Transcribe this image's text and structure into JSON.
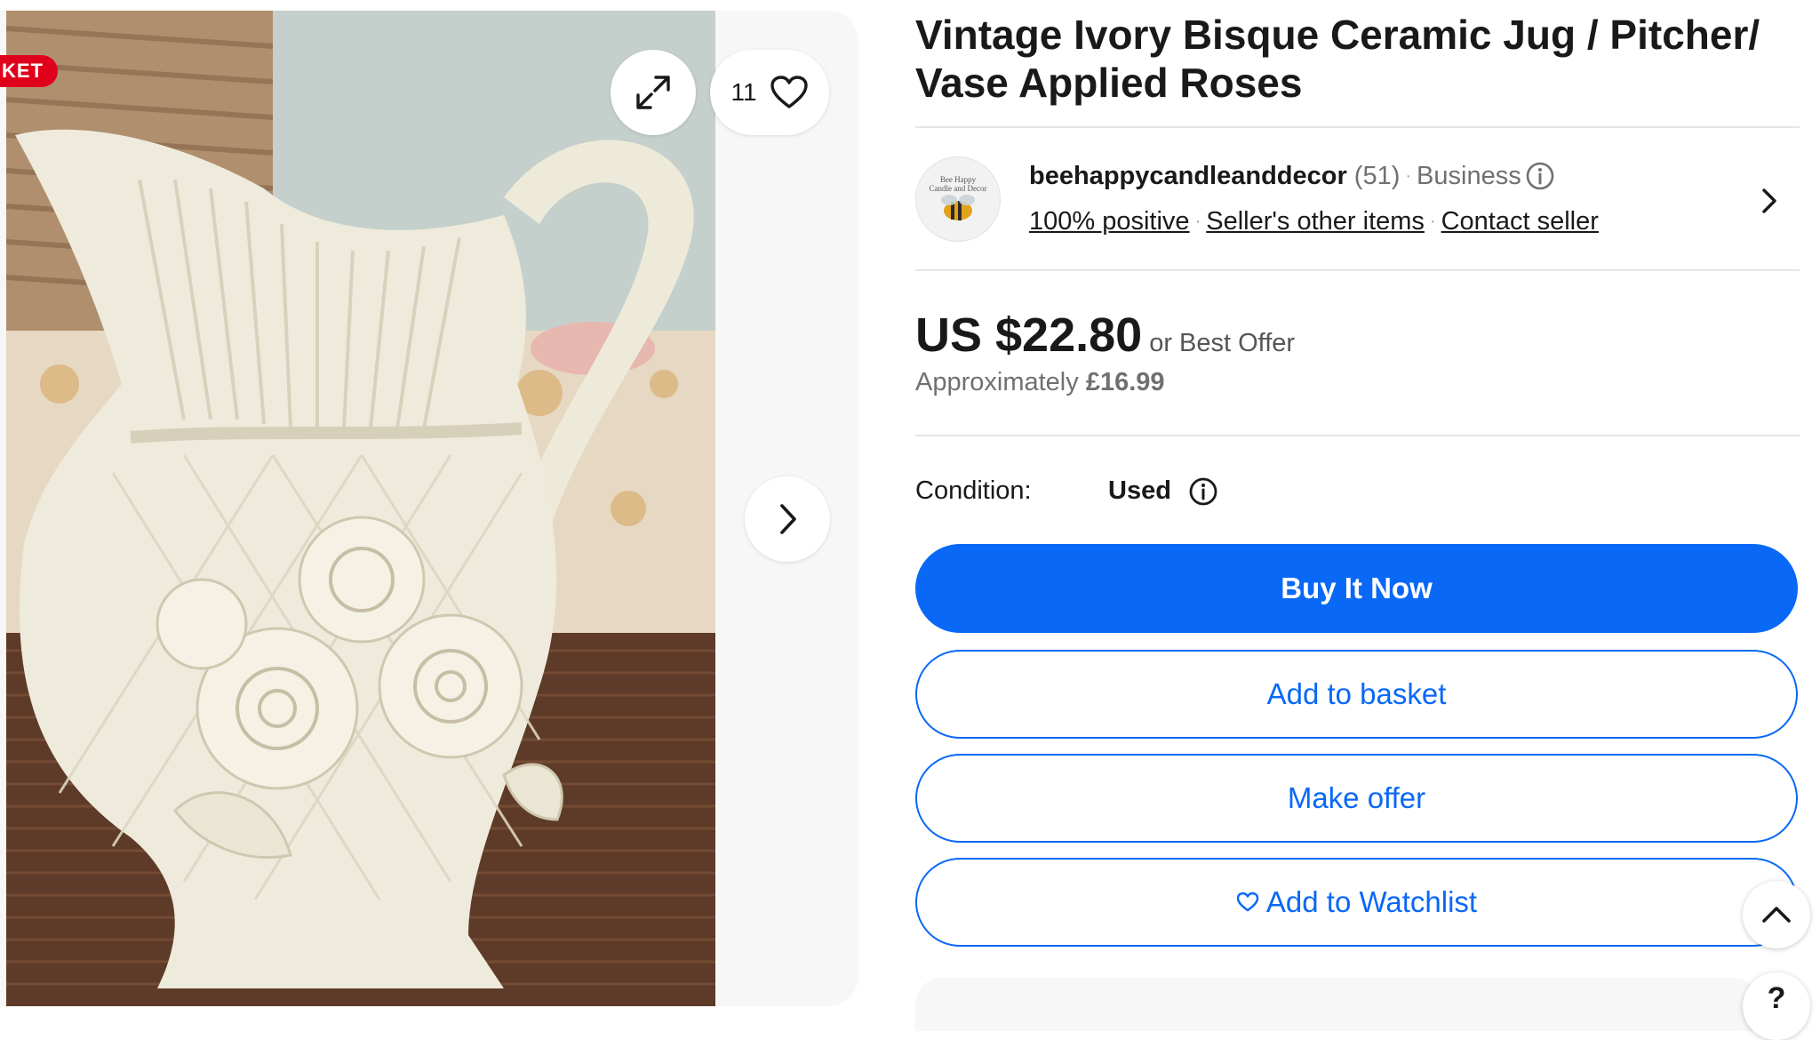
{
  "gallery": {
    "sticker": "KET",
    "watch_count": "11",
    "icons": {
      "expand": "expand-icon",
      "watch": "heart-icon",
      "next": "chevron-right-icon"
    }
  },
  "listing": {
    "title": "Vintage Ivory Bisque Ceramic Jug / Pitcher/ Vase Applied Roses"
  },
  "seller": {
    "logo_line1": "Bee Happy",
    "logo_line2": "Candle and Decor",
    "name": "beehappycandleanddecor",
    "feedback_count": "(51)",
    "separator": "·",
    "type": "Business",
    "positive": "100% positive",
    "other_items": "Seller's other items",
    "contact": "Contact seller"
  },
  "price": {
    "amount": "US $22.80",
    "note": "or Best Offer",
    "approx_label": "Approximately",
    "approx_value": "£16.99"
  },
  "condition": {
    "label": "Condition:",
    "value": "Used"
  },
  "actions": {
    "buy_now": "Buy It Now",
    "add_to_basket": "Add to basket",
    "make_offer": "Make offer",
    "add_to_watchlist": "Add to Watchlist"
  },
  "floating": {
    "help": "?"
  },
  "colors": {
    "accent": "#0968f6",
    "sticker": "#e0001b"
  }
}
